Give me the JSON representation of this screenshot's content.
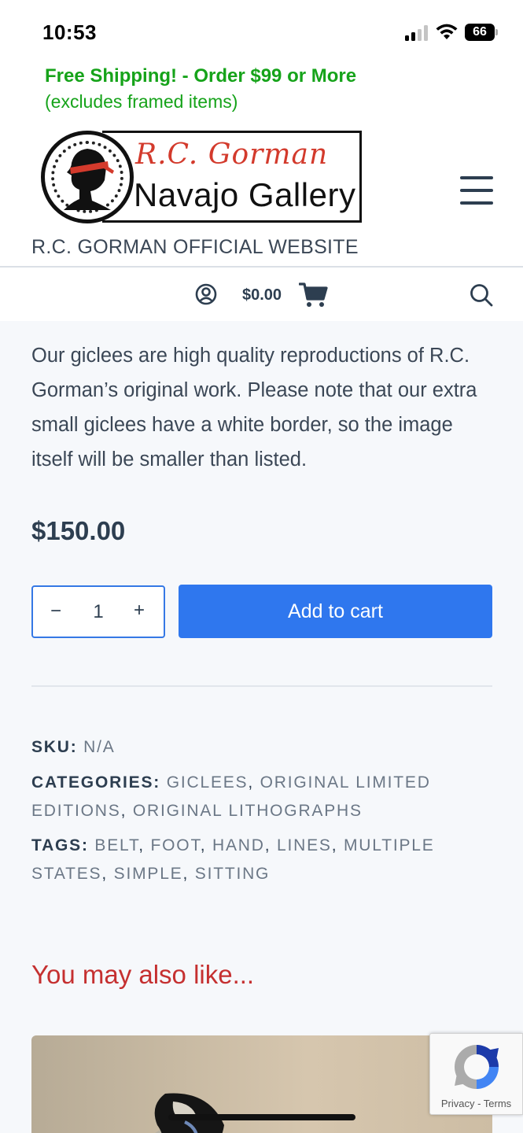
{
  "status_bar": {
    "time": "10:53",
    "battery": "66",
    "icons": [
      "signal-icon",
      "wifi-icon",
      "battery-icon"
    ]
  },
  "header": {
    "promo_line_1": "Free Shipping! - Order $99 or More",
    "promo_line_2": "(excludes framed items)",
    "logo_signature": "R.C. Gorman",
    "logo_name": "Navajo Gallery",
    "site_tagline": "R.C. GORMAN OFFICIAL WEBSITE",
    "menu_icon": "hamburger-menu-icon"
  },
  "utility_bar": {
    "cart_total": "$0.00",
    "icons": [
      "account-icon",
      "cart-icon",
      "search-icon"
    ]
  },
  "product": {
    "description": "Our giclees are high quality reproductions of R.C. Gorman’s original work. Please note that our extra small giclees have a white border, so the image itself will be smaller than listed.",
    "price": "$150.00",
    "quantity": "1",
    "minus_label": "−",
    "plus_label": "+",
    "add_to_cart_label": "Add to cart"
  },
  "meta": {
    "sku_label": "SKU:",
    "sku_value": "N/A",
    "categories_label": "CATEGORIES:",
    "categories": [
      "GICLEES",
      "ORIGINAL LIMITED EDITIONS",
      "ORIGINAL LITHOGRAPHS"
    ],
    "tags_label": "TAGS:",
    "tags": [
      "BELT",
      "FOOT",
      "HAND",
      "LINES",
      "MULTIPLE STATES",
      "SIMPLE",
      "SITTING"
    ]
  },
  "related": {
    "heading": "You may also like..."
  },
  "recaptcha": {
    "privacy": "Privacy",
    "separator": " - ",
    "terms": "Terms"
  },
  "colors": {
    "promo_green": "#16a31a",
    "accent_blue": "#2f77ee",
    "heading_red": "#c53030",
    "text_dark": "#2d3e50"
  }
}
